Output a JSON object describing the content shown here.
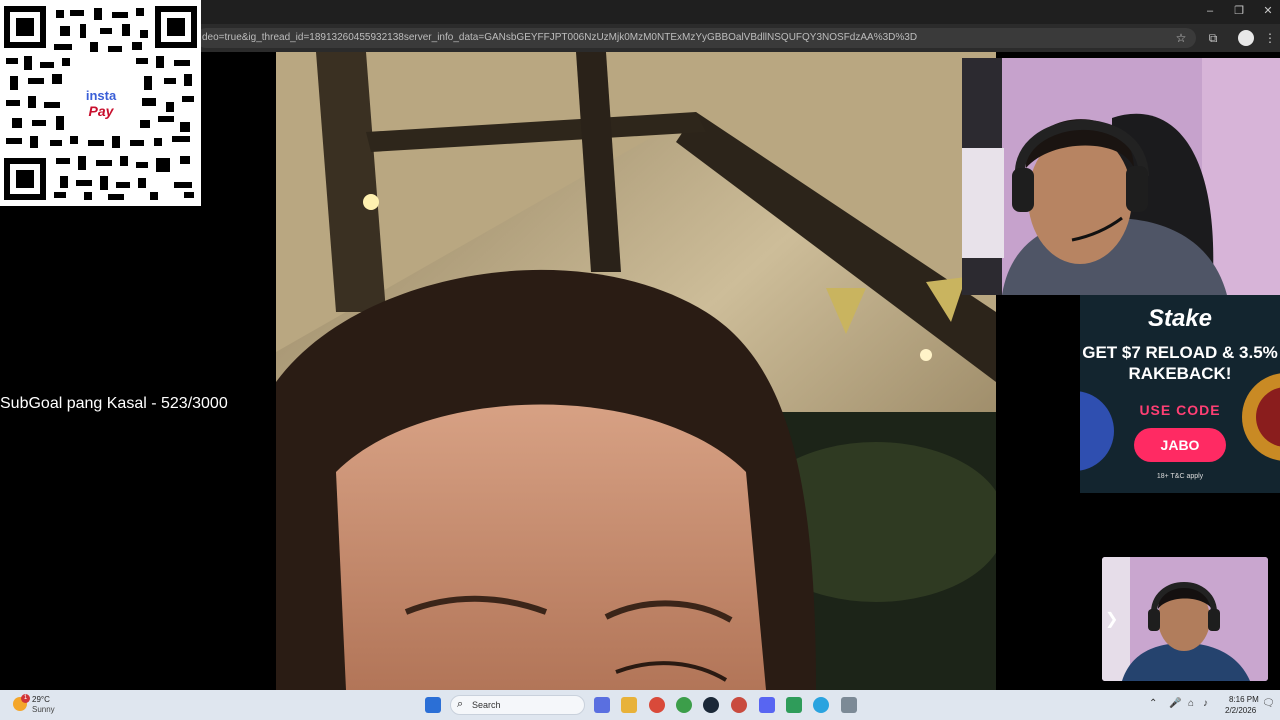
{
  "browser": {
    "url": "deo=true&ig_thread_id=18913260455932138server_info_data=GANsbGEYFFJPT006NzUzMjk0MzM0NTExMzYyGBBOalVBdllNSQUFQY3NOSFdzAA%3D%3D",
    "window_controls": {
      "minimize": "–",
      "restore": "❐",
      "close": "✕"
    },
    "toolbar_icons": {
      "bookmark": "☆",
      "extensions": "⧉",
      "menu": "⋮"
    }
  },
  "overlay": {
    "qr_logo_line1": "insta",
    "qr_logo_line2": "Pay",
    "subgoal_text": "SubGoal pang Kasal - 523/3000"
  },
  "ad": {
    "brand": "Stake",
    "headline": "GET $7 RELOAD & 3.5% RAKEBACK!",
    "use_code_label": "USE CODE",
    "code": "JABO",
    "terms": "18+ T&C apply"
  },
  "taskbar": {
    "weather": {
      "temp": "29°C",
      "condition": "Sunny",
      "badge": "1"
    },
    "search_placeholder": "Search",
    "search_glyph": "⌕",
    "clock_time": "8:16 PM",
    "clock_date": "2/2/2026",
    "cam_chevron": "❯",
    "tray": {
      "chevron": "⌃",
      "mic": "🎤",
      "network": "⌂",
      "volume": "♪",
      "notifications": "🗨"
    },
    "apps": [
      {
        "name": "start",
        "color": "#2b6fd6"
      },
      {
        "name": "copilot",
        "color": "#5a6fe0"
      },
      {
        "name": "file-explorer",
        "color": "#e8b23a"
      },
      {
        "name": "chrome-profile-1",
        "color": "#d94a3a"
      },
      {
        "name": "chrome",
        "color": "#3c9e4a"
      },
      {
        "name": "steam",
        "color": "#1b2838"
      },
      {
        "name": "chrome-profile-2",
        "color": "#c94b3f"
      },
      {
        "name": "discord",
        "color": "#5865f2"
      },
      {
        "name": "app-green",
        "color": "#2f9c5a"
      },
      {
        "name": "telegram",
        "color": "#2aa3df"
      },
      {
        "name": "app-tool",
        "color": "#7c8a96"
      }
    ]
  }
}
